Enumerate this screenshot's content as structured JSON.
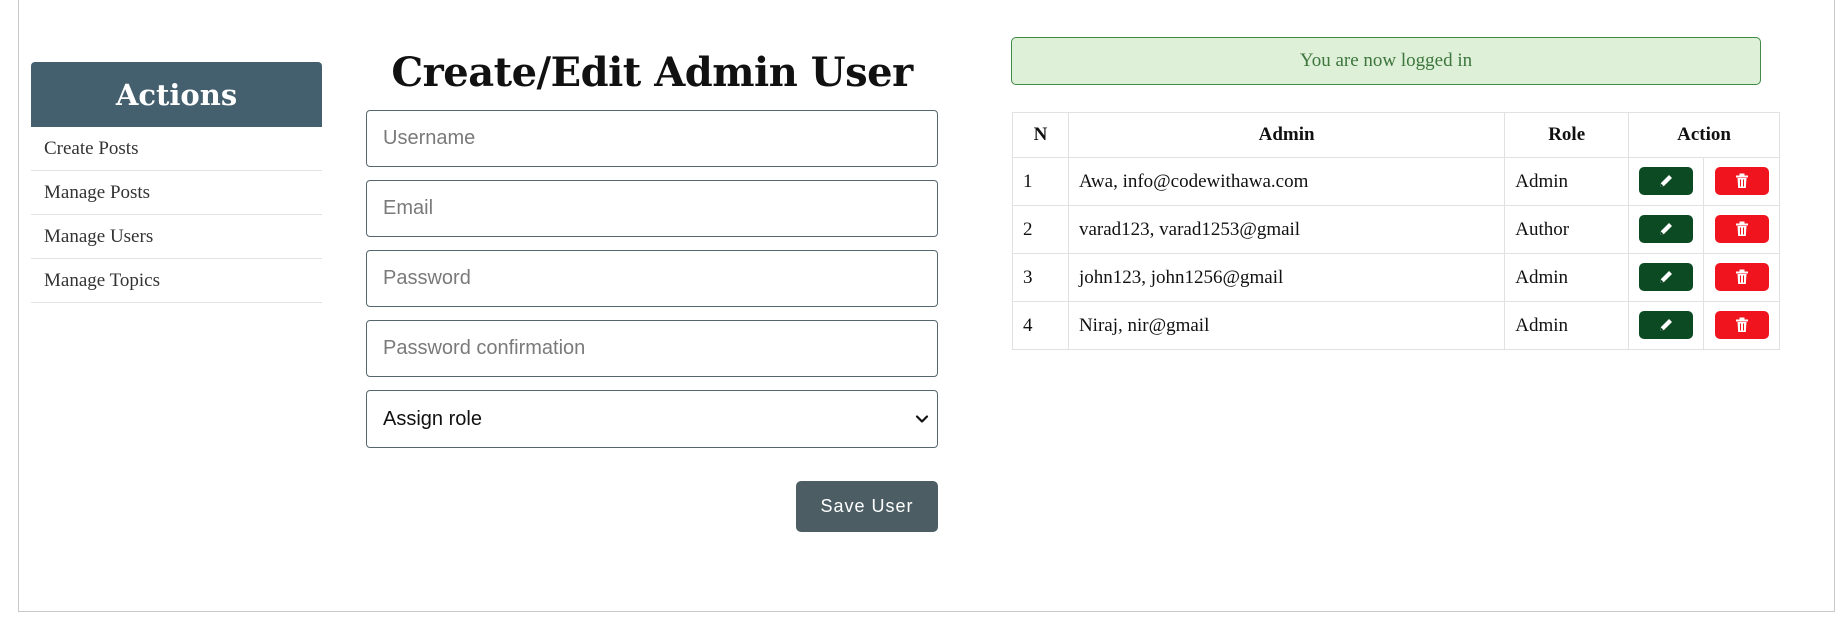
{
  "sidebar": {
    "title": "Actions",
    "items": [
      {
        "label": "Create Posts"
      },
      {
        "label": "Manage Posts"
      },
      {
        "label": "Manage Users"
      },
      {
        "label": "Manage Topics"
      }
    ]
  },
  "form": {
    "title": "Create/Edit Admin User",
    "username_placeholder": "Username",
    "email_placeholder": "Email",
    "password_placeholder": "Password",
    "password_confirm_placeholder": "Password confirmation",
    "role_select_value": "Assign role",
    "save_label": "Save User"
  },
  "alert": {
    "message": "You are now logged in"
  },
  "users_table": {
    "headers": [
      "N",
      "Admin",
      "Role",
      "Action"
    ],
    "rows": [
      {
        "n": "1",
        "admin": "Awa,   info@codewithawa.com",
        "role": "Admin"
      },
      {
        "n": "2",
        "admin": "varad123,   varad1253@gmail",
        "role": "Author"
      },
      {
        "n": "3",
        "admin": "john123,   john1256@gmail",
        "role": "Admin"
      },
      {
        "n": "4",
        "admin": "Niraj,   nir@gmail",
        "role": "Admin"
      }
    ]
  },
  "icons": {
    "edit": "pencil-icon",
    "delete": "trash-icon",
    "select": "chevron-down-icon"
  },
  "colors": {
    "sidebar_header": "#445f6e",
    "save_button": "#4c5e64",
    "edit_button": "#0b4a22",
    "delete_button": "#f0141e",
    "alert_bg": "#dff0d8",
    "alert_text": "#3c763d"
  }
}
